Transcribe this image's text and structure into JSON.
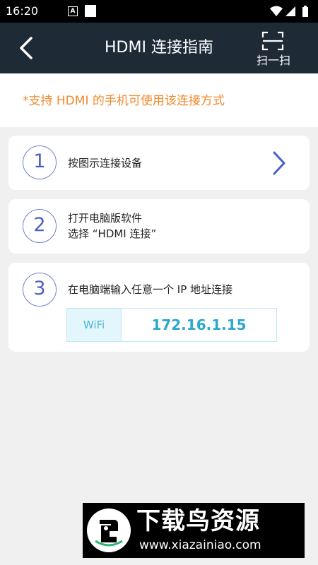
{
  "status_bar": {
    "time": "16:20",
    "a_badge": "A",
    "icons": [
      "notification-a-icon",
      "square-notification-icon",
      "wifi-icon",
      "signal-icon",
      "battery-icon"
    ]
  },
  "header": {
    "title": "HDMI 连接指南",
    "scan_label": "扫一扫",
    "background": "#1f2a37"
  },
  "notice": {
    "text": "*支持 HDMI 的手机可使用该连接方式",
    "color": "#f28a2e"
  },
  "steps": [
    {
      "number": "1",
      "text": "按图示连接设备"
    },
    {
      "number": "2",
      "line1": "打开电脑版软件",
      "line2": "选择 “HDMI 连接”"
    },
    {
      "number": "3",
      "text": "在电脑端输入任意一个 IP 地址连接"
    }
  ],
  "ip_list": [
    {
      "label": "WiFi",
      "ip": "172.16.1.15"
    }
  ],
  "watermark": {
    "title": "下载鸟资源",
    "url": "www.xiazainiao.com"
  },
  "colors": {
    "accent_blue": "#4a5fc8",
    "ip_blue": "#2ba8cf",
    "page_background": "#f0f0f0"
  }
}
